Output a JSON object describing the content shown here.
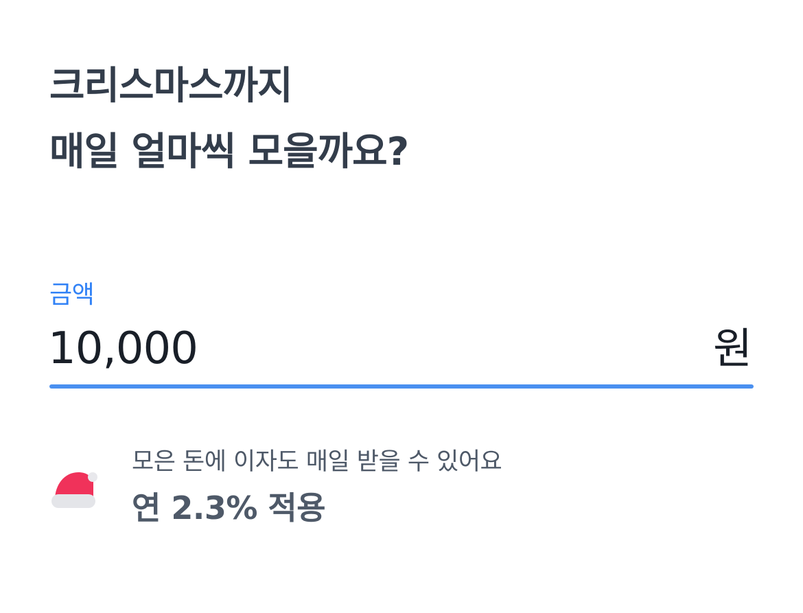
{
  "header": {
    "title_line1": "크리스마스까지",
    "title_line2": "매일 얼마씩 모을까요?"
  },
  "amount_field": {
    "label": "금액",
    "value": "10,000",
    "unit": "원",
    "accent_color": "#3182f6"
  },
  "interest_info": {
    "icon": "santa-hat-icon",
    "description": "모은 돈에 이자도 매일 받을 수 있어요",
    "rate_text": "연 2.3% 적용"
  }
}
